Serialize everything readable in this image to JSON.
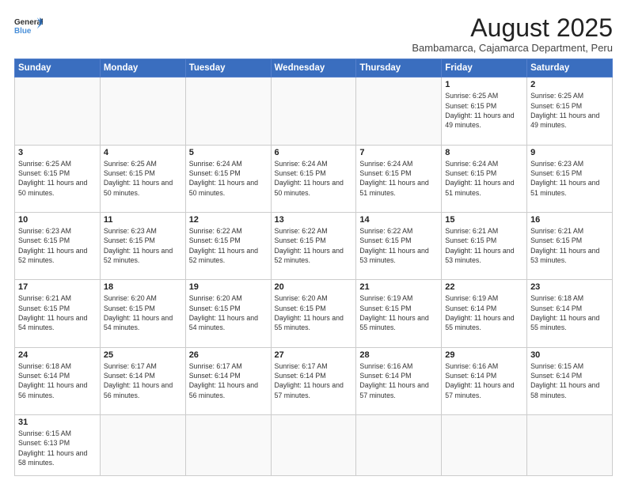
{
  "header": {
    "logo_general": "General",
    "logo_blue": "Blue",
    "month_title": "August 2025",
    "subtitle": "Bambamarca, Cajamarca Department, Peru"
  },
  "weekdays": [
    "Sunday",
    "Monday",
    "Tuesday",
    "Wednesday",
    "Thursday",
    "Friday",
    "Saturday"
  ],
  "weeks": [
    [
      {
        "day": "",
        "info": ""
      },
      {
        "day": "",
        "info": ""
      },
      {
        "day": "",
        "info": ""
      },
      {
        "day": "",
        "info": ""
      },
      {
        "day": "",
        "info": ""
      },
      {
        "day": "1",
        "info": "Sunrise: 6:25 AM\nSunset: 6:15 PM\nDaylight: 11 hours and 49 minutes."
      },
      {
        "day": "2",
        "info": "Sunrise: 6:25 AM\nSunset: 6:15 PM\nDaylight: 11 hours and 49 minutes."
      }
    ],
    [
      {
        "day": "3",
        "info": "Sunrise: 6:25 AM\nSunset: 6:15 PM\nDaylight: 11 hours and 50 minutes."
      },
      {
        "day": "4",
        "info": "Sunrise: 6:25 AM\nSunset: 6:15 PM\nDaylight: 11 hours and 50 minutes."
      },
      {
        "day": "5",
        "info": "Sunrise: 6:24 AM\nSunset: 6:15 PM\nDaylight: 11 hours and 50 minutes."
      },
      {
        "day": "6",
        "info": "Sunrise: 6:24 AM\nSunset: 6:15 PM\nDaylight: 11 hours and 50 minutes."
      },
      {
        "day": "7",
        "info": "Sunrise: 6:24 AM\nSunset: 6:15 PM\nDaylight: 11 hours and 51 minutes."
      },
      {
        "day": "8",
        "info": "Sunrise: 6:24 AM\nSunset: 6:15 PM\nDaylight: 11 hours and 51 minutes."
      },
      {
        "day": "9",
        "info": "Sunrise: 6:23 AM\nSunset: 6:15 PM\nDaylight: 11 hours and 51 minutes."
      }
    ],
    [
      {
        "day": "10",
        "info": "Sunrise: 6:23 AM\nSunset: 6:15 PM\nDaylight: 11 hours and 52 minutes."
      },
      {
        "day": "11",
        "info": "Sunrise: 6:23 AM\nSunset: 6:15 PM\nDaylight: 11 hours and 52 minutes."
      },
      {
        "day": "12",
        "info": "Sunrise: 6:22 AM\nSunset: 6:15 PM\nDaylight: 11 hours and 52 minutes."
      },
      {
        "day": "13",
        "info": "Sunrise: 6:22 AM\nSunset: 6:15 PM\nDaylight: 11 hours and 52 minutes."
      },
      {
        "day": "14",
        "info": "Sunrise: 6:22 AM\nSunset: 6:15 PM\nDaylight: 11 hours and 53 minutes."
      },
      {
        "day": "15",
        "info": "Sunrise: 6:21 AM\nSunset: 6:15 PM\nDaylight: 11 hours and 53 minutes."
      },
      {
        "day": "16",
        "info": "Sunrise: 6:21 AM\nSunset: 6:15 PM\nDaylight: 11 hours and 53 minutes."
      }
    ],
    [
      {
        "day": "17",
        "info": "Sunrise: 6:21 AM\nSunset: 6:15 PM\nDaylight: 11 hours and 54 minutes."
      },
      {
        "day": "18",
        "info": "Sunrise: 6:20 AM\nSunset: 6:15 PM\nDaylight: 11 hours and 54 minutes."
      },
      {
        "day": "19",
        "info": "Sunrise: 6:20 AM\nSunset: 6:15 PM\nDaylight: 11 hours and 54 minutes."
      },
      {
        "day": "20",
        "info": "Sunrise: 6:20 AM\nSunset: 6:15 PM\nDaylight: 11 hours and 55 minutes."
      },
      {
        "day": "21",
        "info": "Sunrise: 6:19 AM\nSunset: 6:15 PM\nDaylight: 11 hours and 55 minutes."
      },
      {
        "day": "22",
        "info": "Sunrise: 6:19 AM\nSunset: 6:14 PM\nDaylight: 11 hours and 55 minutes."
      },
      {
        "day": "23",
        "info": "Sunrise: 6:18 AM\nSunset: 6:14 PM\nDaylight: 11 hours and 55 minutes."
      }
    ],
    [
      {
        "day": "24",
        "info": "Sunrise: 6:18 AM\nSunset: 6:14 PM\nDaylight: 11 hours and 56 minutes."
      },
      {
        "day": "25",
        "info": "Sunrise: 6:17 AM\nSunset: 6:14 PM\nDaylight: 11 hours and 56 minutes."
      },
      {
        "day": "26",
        "info": "Sunrise: 6:17 AM\nSunset: 6:14 PM\nDaylight: 11 hours and 56 minutes."
      },
      {
        "day": "27",
        "info": "Sunrise: 6:17 AM\nSunset: 6:14 PM\nDaylight: 11 hours and 57 minutes."
      },
      {
        "day": "28",
        "info": "Sunrise: 6:16 AM\nSunset: 6:14 PM\nDaylight: 11 hours and 57 minutes."
      },
      {
        "day": "29",
        "info": "Sunrise: 6:16 AM\nSunset: 6:14 PM\nDaylight: 11 hours and 57 minutes."
      },
      {
        "day": "30",
        "info": "Sunrise: 6:15 AM\nSunset: 6:14 PM\nDaylight: 11 hours and 58 minutes."
      }
    ],
    [
      {
        "day": "31",
        "info": "Sunrise: 6:15 AM\nSunset: 6:13 PM\nDaylight: 11 hours and 58 minutes."
      },
      {
        "day": "",
        "info": ""
      },
      {
        "day": "",
        "info": ""
      },
      {
        "day": "",
        "info": ""
      },
      {
        "day": "",
        "info": ""
      },
      {
        "day": "",
        "info": ""
      },
      {
        "day": "",
        "info": ""
      }
    ]
  ]
}
